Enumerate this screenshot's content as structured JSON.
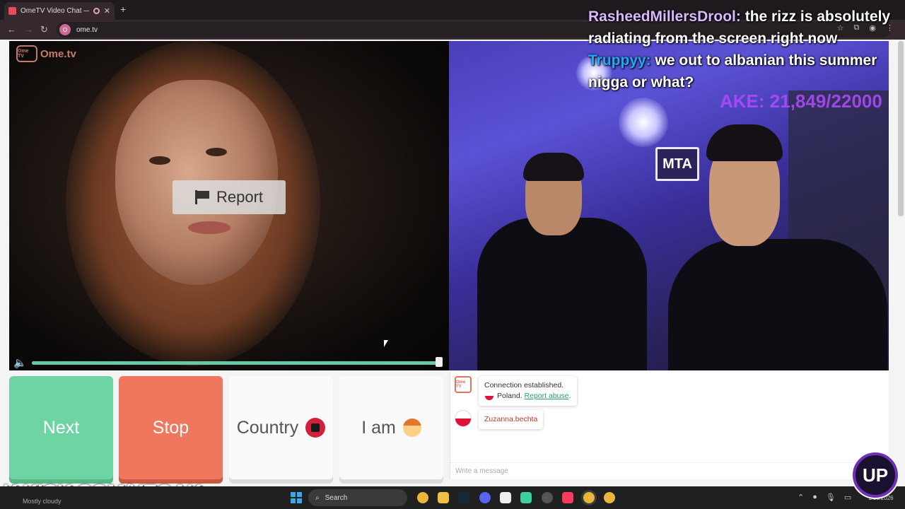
{
  "browser": {
    "tab_title": "OmeTV Video Chat — Ome",
    "tab_close": "✕",
    "new_tab": "+",
    "url": "ome.tv",
    "site_icon": "O"
  },
  "app": {
    "logo_text": "Ome.tv",
    "logo_tv": "Ome TV",
    "report_label": "Report",
    "volume_level": 0.99
  },
  "self_video": {
    "sign_text": "MTA"
  },
  "controls": {
    "next_label": "Next",
    "stop_label": "Stop",
    "country_label": "Country",
    "iam_label": "I am"
  },
  "chat": {
    "logo_text": "Ome TV",
    "system_line1": "Connection established.",
    "system_country": "Poland.",
    "report_abuse": "Report abuse",
    "system_period": ".",
    "stranger_username": "Zuzanna.bechta",
    "input_placeholder": "Write a message"
  },
  "stream_overlay": {
    "msg1_user": "RasheedMillersDrool:",
    "msg1_text": " the rizz is absolutely radiating from the screen right now",
    "msg2_user": "Truppyy:",
    "msg2_text": " we out to albanian this summer nigga or what?",
    "goal_text": "AKE: 21,849/22000",
    "kick_text": "K KICK.COM/YEOAK",
    "badge_text": "UP"
  },
  "taskbar": {
    "weather": "Mostly cloudy",
    "search_label": "Search",
    "clock": "1/10/2026"
  },
  "colors": {
    "next_green": "#6fd4a4",
    "stop_red": "#ef775d",
    "volume_green": "#67c9a4",
    "link_green": "#2b9a78"
  }
}
